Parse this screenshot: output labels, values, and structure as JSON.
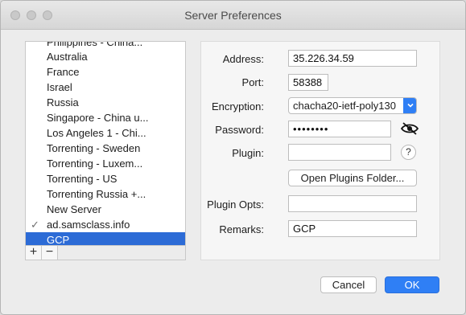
{
  "window": {
    "title": "Server Preferences"
  },
  "server_list": {
    "items": [
      {
        "label": "Philippines - China..."
      },
      {
        "label": "Australia"
      },
      {
        "label": "France"
      },
      {
        "label": "Israel"
      },
      {
        "label": "Russia"
      },
      {
        "label": "Singapore - China u..."
      },
      {
        "label": "Los Angeles 1 - Chi..."
      },
      {
        "label": "Torrenting - Sweden"
      },
      {
        "label": "Torrenting - Luxem..."
      },
      {
        "label": "Torrenting - US"
      },
      {
        "label": "Torrenting Russia +..."
      },
      {
        "label": "New Server"
      },
      {
        "label": "ad.samsclass.info",
        "checked": true
      },
      {
        "label": "GCP",
        "selected": true
      }
    ],
    "add_label": "+",
    "remove_label": "−"
  },
  "form": {
    "address": {
      "label": "Address:",
      "value": "35.226.34.59"
    },
    "port": {
      "label": "Port:",
      "value": "58388"
    },
    "encryption": {
      "label": "Encryption:",
      "value": "chacha20-ietf-poly130"
    },
    "password": {
      "label": "Password:",
      "value": "••••••••"
    },
    "plugin": {
      "label": "Plugin:",
      "value": ""
    },
    "open_plugins_folder": "Open Plugins Folder...",
    "plugin_opts": {
      "label": "Plugin Opts:",
      "value": ""
    },
    "remarks": {
      "label": "Remarks:",
      "value": "GCP"
    },
    "help_label": "?"
  },
  "footer": {
    "cancel_label": "Cancel",
    "ok_label": "OK"
  },
  "colors": {
    "accent": "#2f7ff5",
    "selection": "#2c6bd6"
  }
}
